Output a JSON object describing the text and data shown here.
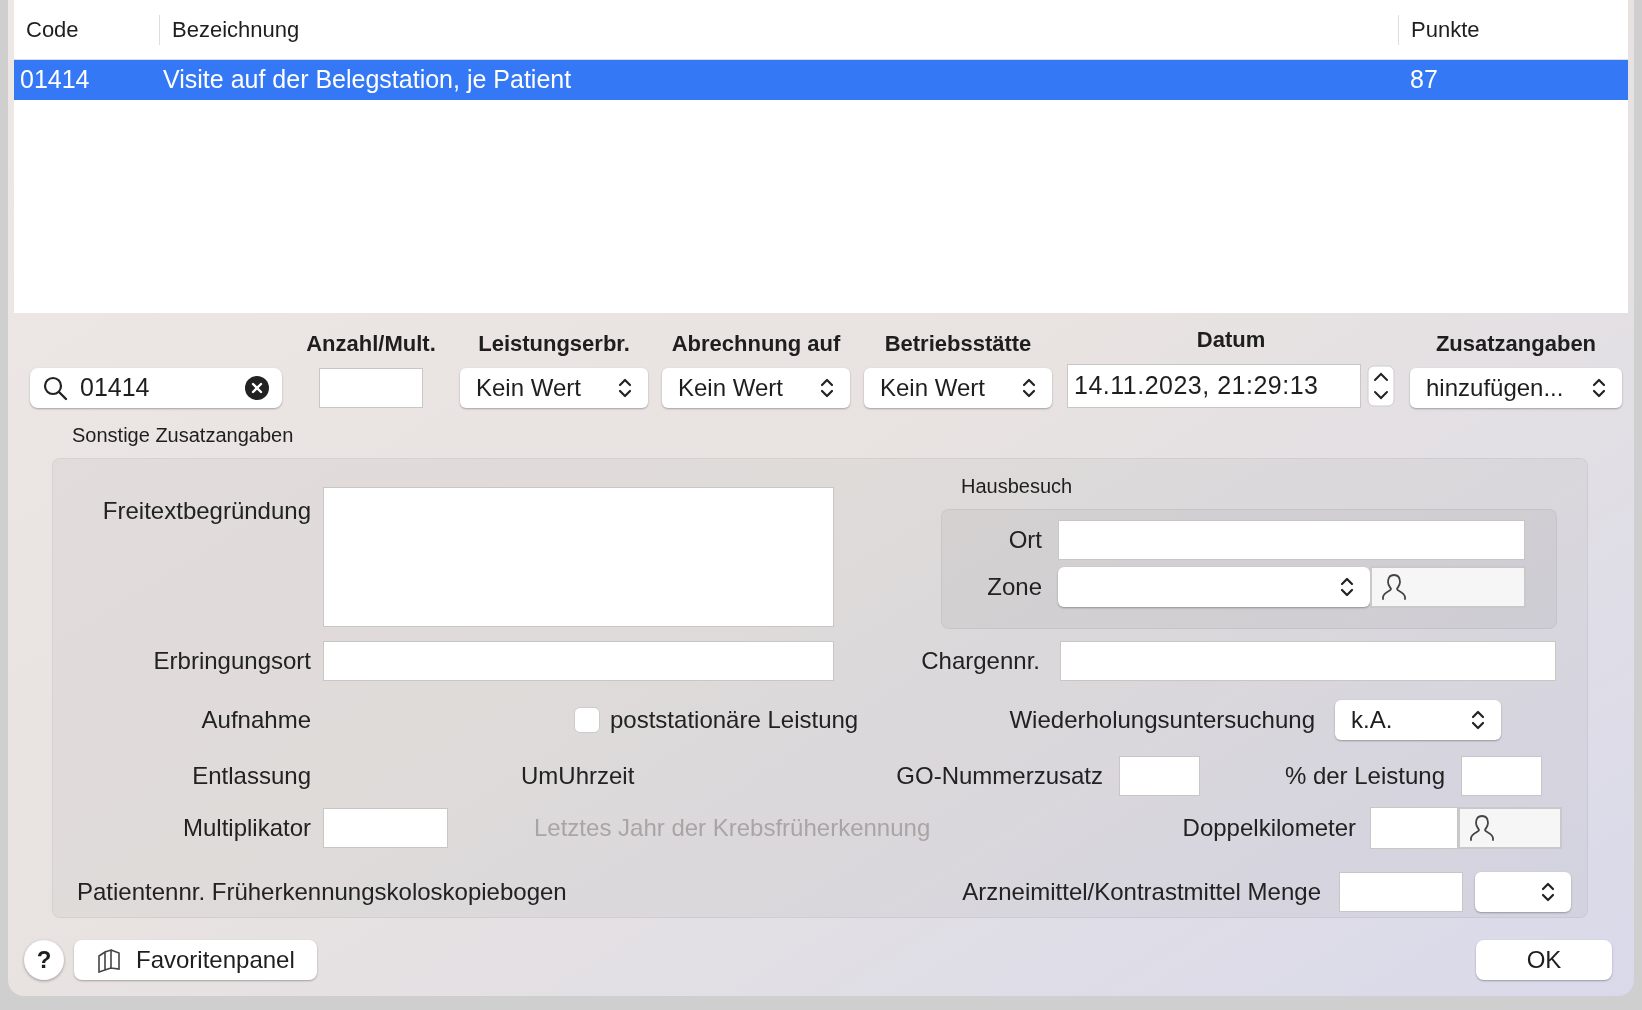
{
  "table": {
    "columns": [
      "Code",
      "Bezeichnung",
      "Punkte"
    ],
    "rows": [
      {
        "code": "01414",
        "name": "Visite auf der Belegstation, je Patient",
        "points": "87",
        "selected": true
      }
    ]
  },
  "search": {
    "value": "01414"
  },
  "controls": [
    {
      "kind": "field",
      "label": "Anzahl/Mult."
    },
    {
      "kind": "select",
      "label": "Leistungserbr.",
      "value": "Kein Wert"
    },
    {
      "kind": "select",
      "label": "Abrechnung auf",
      "value": "Kein Wert"
    },
    {
      "kind": "select",
      "label": "Betriebsstätte",
      "value": "Kein Wert"
    },
    {
      "kind": "stepper",
      "label": "Datum",
      "value": "14.11.2023, 21:29:13"
    },
    {
      "kind": "select",
      "label": "Zusatzangaben",
      "value": "hinzufügen..."
    }
  ],
  "section": {
    "title": "Sonstige Zusatzangaben",
    "freitext": "Freitextbegründung",
    "hausbesuch": {
      "title": "Hausbesuch",
      "ort": "Ort",
      "zone": "Zone"
    },
    "erbringungsort": "Erbringungsort",
    "chargennr": "Chargennr.",
    "aufnahme": "Aufnahme",
    "poststationaer": {
      "label": "poststationäre Leistung",
      "checked": false
    },
    "wiederholung": {
      "label": "Wiederholungsuntersuchung",
      "value": "k.A."
    },
    "entlassung": "Entlassung",
    "umuhrzeit": "UmUhrzeit",
    "go_nummerzusatz": "GO-Nummerzusatz",
    "prozent": "% der Leistung",
    "multiplikator": "Multiplikator",
    "letztes_jahr": {
      "label": "Letztes Jahr der Krebsfrüherkennung",
      "disabled": true
    },
    "doppelkilometer": "Doppelkilometer",
    "patientennr": "Patientennr. Früherkennungskoloskopiebogen",
    "arzneimittel": "Arzneimittel/Kontrastmittel Menge"
  },
  "footer": {
    "help": "?",
    "favorites": "Favoritenpanel",
    "ok": "OK"
  }
}
